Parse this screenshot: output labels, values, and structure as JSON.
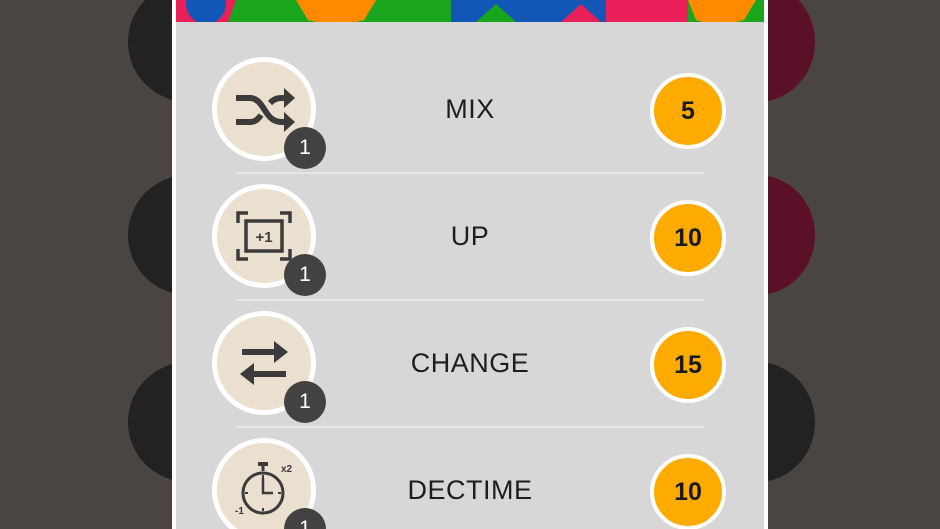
{
  "powerups": [
    {
      "label": "MIX",
      "icon": "shuffle-icon",
      "count": "1",
      "price": "5"
    },
    {
      "label": "UP",
      "icon": "plus-one-frame-icon",
      "count": "1",
      "price": "10"
    },
    {
      "label": "CHANGE",
      "icon": "swap-arrows-icon",
      "count": "1",
      "price": "15"
    },
    {
      "label": "DECTIME",
      "icon": "stopwatch-icon",
      "icon_text": {
        "minus": "-1",
        "times": "x2"
      },
      "count": "1",
      "price": "10"
    }
  ],
  "colors": {
    "background": "#4a4541",
    "panel": "#d7d7d7",
    "icon_circle": "#ebdfd0",
    "count_badge": "#424242",
    "price_coin": "#fdab00"
  }
}
